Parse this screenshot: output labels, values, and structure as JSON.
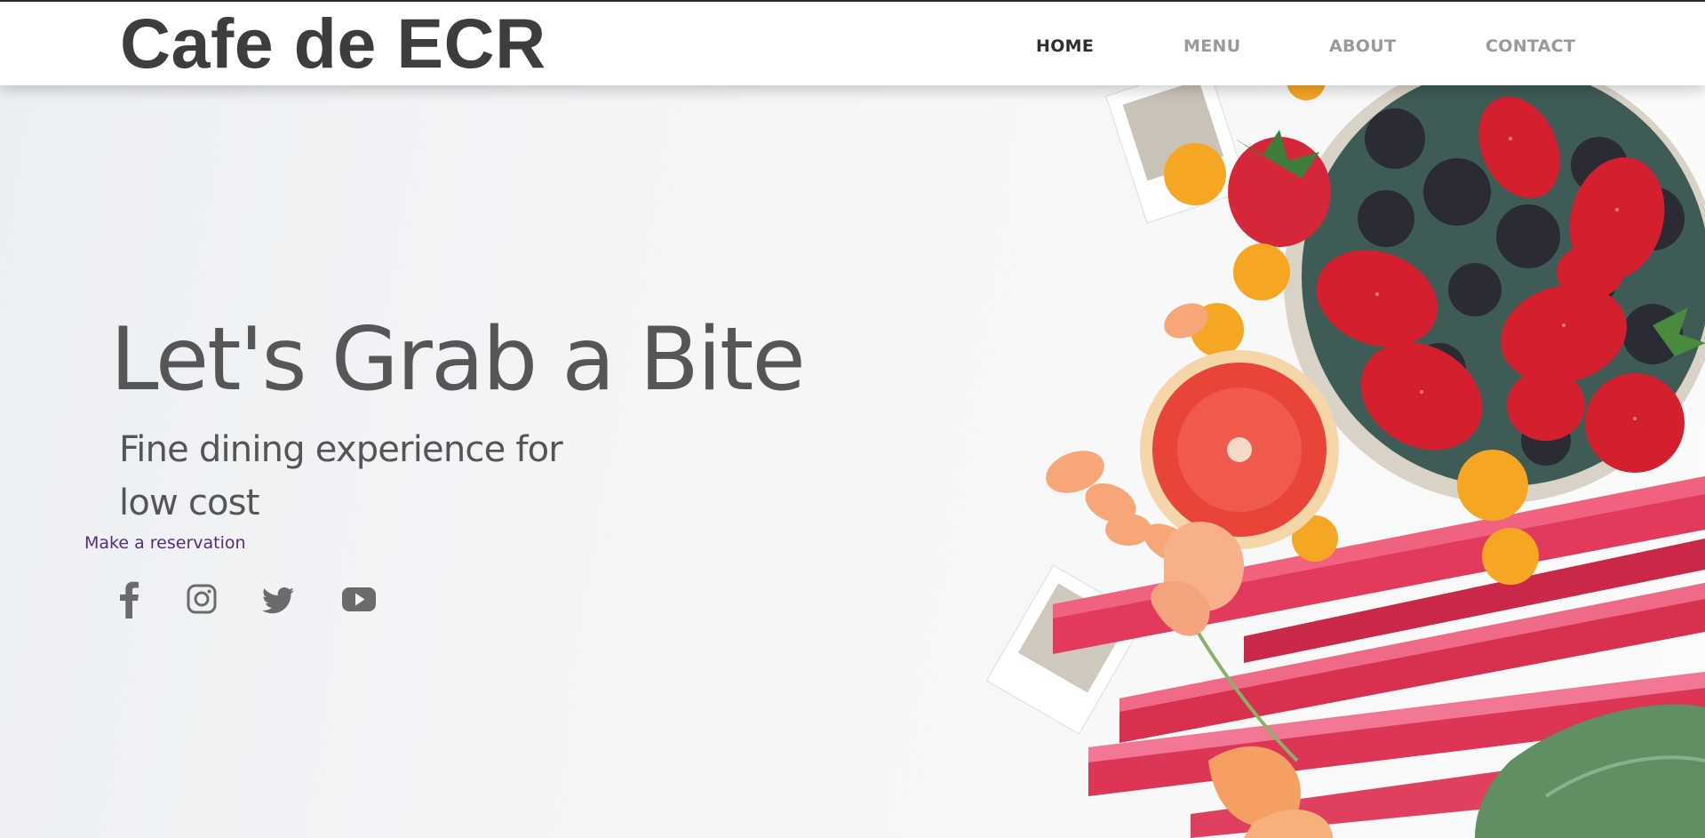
{
  "header": {
    "brand": "Cafe de ECR",
    "nav": [
      {
        "label": "HOME",
        "active": true
      },
      {
        "label": "MENU",
        "active": false
      },
      {
        "label": "ABOUT",
        "active": false
      },
      {
        "label": "CONTACT",
        "active": false
      }
    ]
  },
  "hero": {
    "headline": "Let's Grab a Bite",
    "subline_1": "Fine dining experience for",
    "subline_2": "low cost",
    "reservation_link": "Make a reservation"
  },
  "socials": [
    {
      "icon": "facebook-icon"
    },
    {
      "icon": "instagram-icon"
    },
    {
      "icon": "twitter-icon"
    },
    {
      "icon": "youtube-icon"
    }
  ],
  "colors": {
    "text_dark": "#3d3d3d",
    "nav_inactive": "#9a9a9a",
    "link": "#5a2a78",
    "background": "#f1f3f5"
  }
}
